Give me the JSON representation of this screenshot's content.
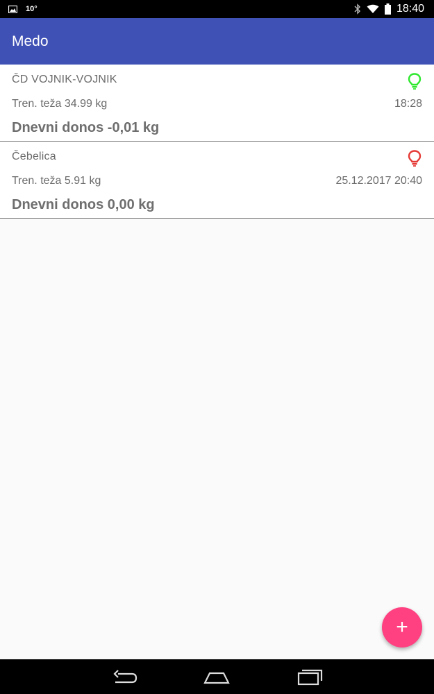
{
  "status_bar": {
    "temperature": "10°",
    "time": "18:40",
    "icons": [
      "image-icon",
      "bluetooth-icon",
      "wifi-icon",
      "battery-icon"
    ]
  },
  "app_bar": {
    "title": "Medo",
    "color": "#3f51b5"
  },
  "hives": [
    {
      "name": "ČD VOJNIK-VOJNIK",
      "weight": "Tren. teža 34.99 kg",
      "time": "18:28",
      "yield": "Dnevni donos -0,01 kg",
      "status": "online",
      "bulb_color": "#2ee82e"
    },
    {
      "name": "Čebelica",
      "weight": "Tren. teža 5.91 kg",
      "time": "25.12.2017 20:40",
      "yield": "Dnevni donos 0,00 kg",
      "status": "offline",
      "bulb_color": "#e53935"
    }
  ],
  "fab": {
    "label": "+",
    "color": "#ff4081",
    "icon": "add-icon"
  },
  "nav_bar": {
    "icons": [
      "back-icon",
      "home-icon",
      "recents-icon"
    ]
  }
}
